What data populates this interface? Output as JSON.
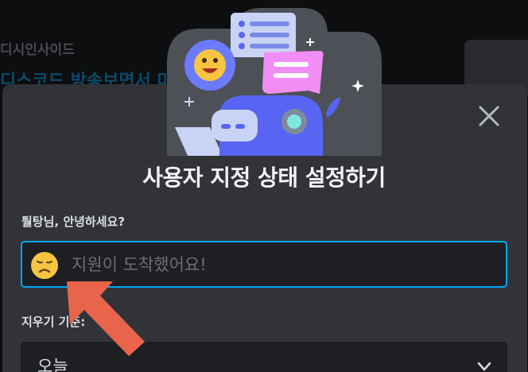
{
  "background": {
    "breadcrumb": "디시인사이드",
    "headline": "디스코드 방송보면서 마이크 소리 지능격 해결 어"
  },
  "modal": {
    "title": "사용자 지정 상태 설정하기",
    "greeting": "퉐탕님, 안녕하세요?",
    "status_input": {
      "placeholder": "지원이 도착했어요!",
      "value": ""
    },
    "emoji_icon": "disappointed-face-emoji",
    "clear_after": {
      "label": "지우기 기준:",
      "selected": "오늘"
    },
    "close_icon": "close-icon",
    "chevron_icon": "chevron-down-icon"
  },
  "colors": {
    "modal_bg": "#313338",
    "input_bg": "#1e1f22",
    "focus_border": "#00a8fc",
    "arrow": "#e8644a",
    "blurple": "#5865f2"
  }
}
